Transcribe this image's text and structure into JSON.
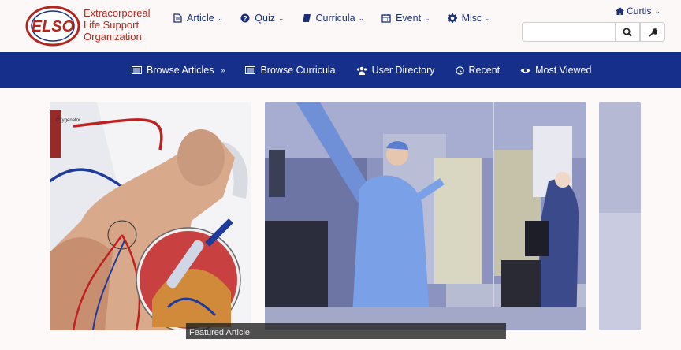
{
  "brand": {
    "line1": "Extracorporeal",
    "line2": "Life Support",
    "line3": "Organization",
    "logo_text": "ELSO"
  },
  "top_nav": [
    {
      "label": "Article",
      "icon": "file-icon"
    },
    {
      "label": "Quiz",
      "icon": "question-circle-icon"
    },
    {
      "label": "Curricula",
      "icon": "book-icon"
    },
    {
      "label": "Event",
      "icon": "calendar-icon"
    },
    {
      "label": "Misc",
      "icon": "gear-icon"
    }
  ],
  "user": {
    "name": "Curtis",
    "icon": "home-icon"
  },
  "search": {
    "placeholder": "",
    "value": ""
  },
  "main_nav": [
    {
      "label": "Browse Articles",
      "icon": "list-icon",
      "has_caret": true
    },
    {
      "label": "Browse Curricula",
      "icon": "list-icon"
    },
    {
      "label": "User Directory",
      "icon": "users-icon"
    },
    {
      "label": "Recent",
      "icon": "clock-icon"
    },
    {
      "label": "Most Viewed",
      "icon": "eye-icon"
    }
  ],
  "slides": {
    "slide1_label": "Oxygenator",
    "caption": "Featured Article"
  },
  "colors": {
    "navbar": "#152f8a",
    "link": "#1a2f7a",
    "brand_red": "#b3261e"
  }
}
